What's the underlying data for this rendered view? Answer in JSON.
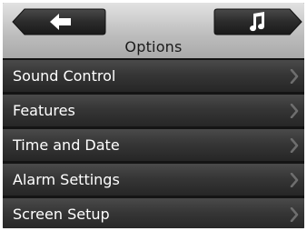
{
  "header": {
    "title": "Options",
    "back_button_icon": "arrow-left-icon",
    "music_button_icon": "music-note-icon"
  },
  "menu": {
    "items": [
      {
        "label": "Sound Control",
        "icon": "chevron-right-icon"
      },
      {
        "label": "Features",
        "icon": "chevron-right-icon"
      },
      {
        "label": "Time and Date",
        "icon": "chevron-right-icon"
      },
      {
        "label": "Alarm Settings",
        "icon": "chevron-right-icon"
      },
      {
        "label": "Screen Setup",
        "icon": "chevron-right-icon"
      }
    ]
  },
  "colors": {
    "header_gradient_top": "#e2e2e2",
    "header_gradient_bottom": "#a9a9a9",
    "menu_item_top": "#4a4a4a",
    "menu_item_bottom": "#262626",
    "menu_text": "#ffffff",
    "button_fill": "#2e2e2e"
  }
}
